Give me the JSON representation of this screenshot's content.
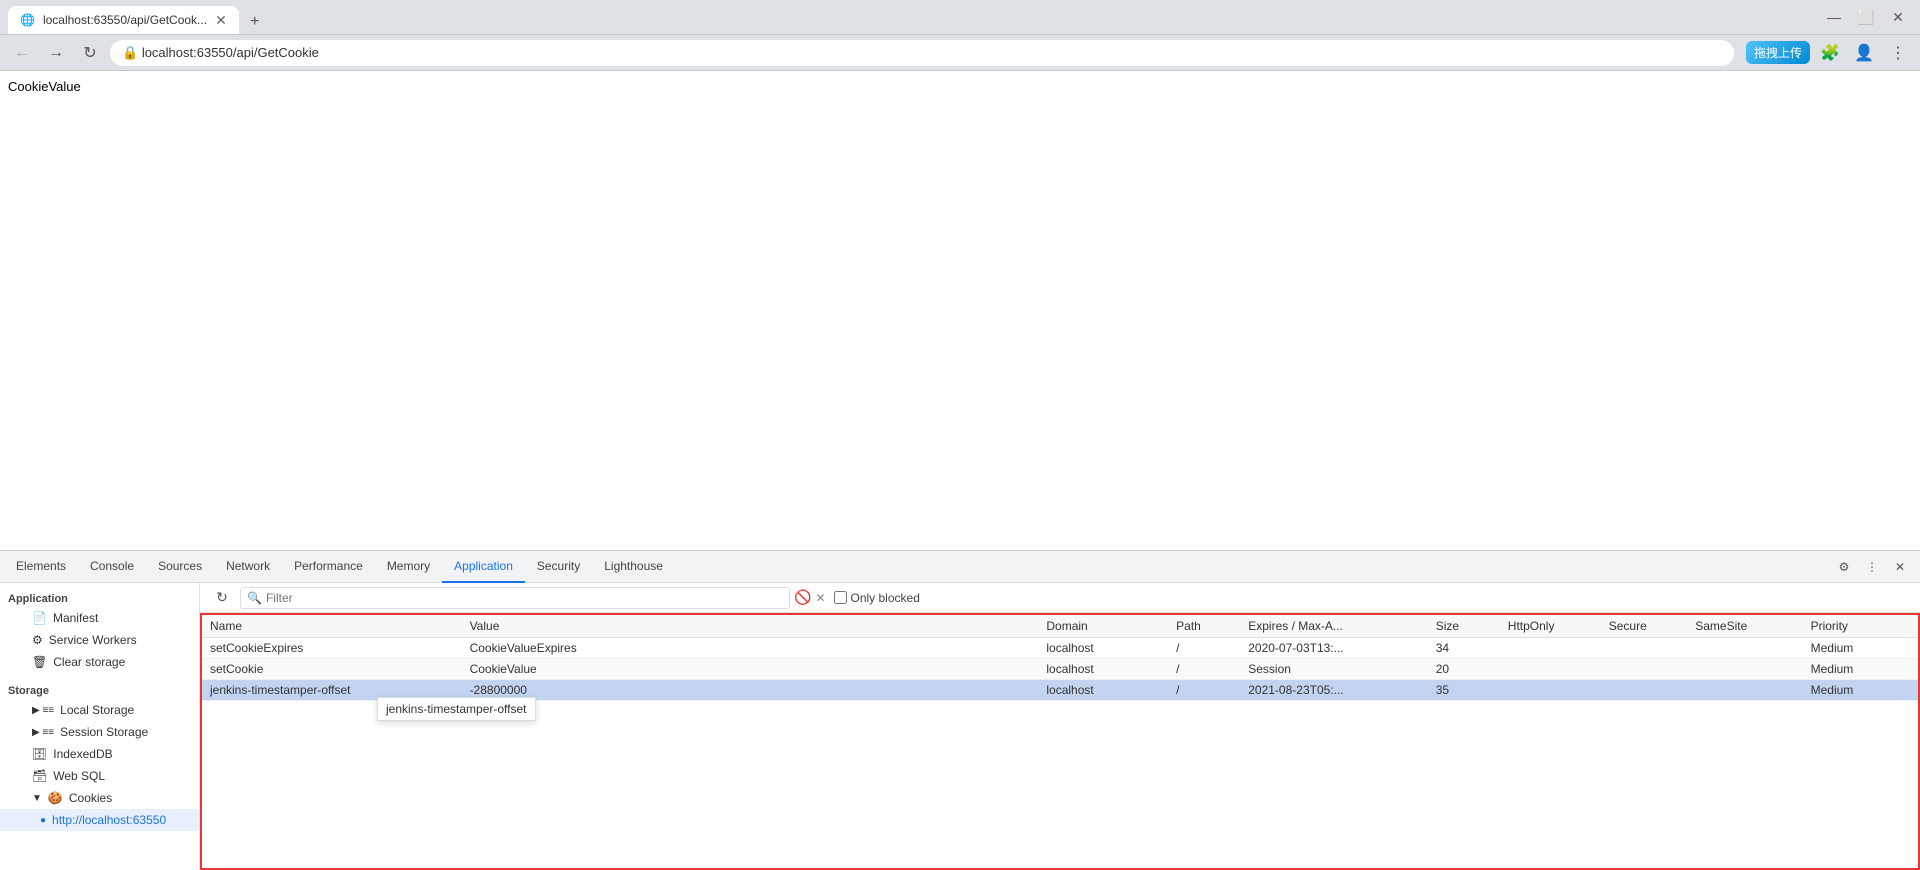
{
  "browser": {
    "tab_title": "localhost:63550/api/GetCook...",
    "tab_favicon": "🌐",
    "url": "localhost:63550/api/GetCookie",
    "new_tab_btn": "+",
    "back_disabled": false,
    "forward_disabled": true,
    "refresh_icon": "↻",
    "ext_label": "拖拽上传",
    "win_minimize": "—",
    "win_maximize": "⬜",
    "win_close": "✕"
  },
  "page": {
    "body_text": "CookieValue"
  },
  "devtools": {
    "tabs": [
      {
        "id": "elements",
        "label": "Elements"
      },
      {
        "id": "console",
        "label": "Console"
      },
      {
        "id": "sources",
        "label": "Sources"
      },
      {
        "id": "network",
        "label": "Network"
      },
      {
        "id": "performance",
        "label": "Performance"
      },
      {
        "id": "memory",
        "label": "Memory"
      },
      {
        "id": "application",
        "label": "Application",
        "active": true
      },
      {
        "id": "security",
        "label": "Security"
      },
      {
        "id": "lighthouse",
        "label": "Lighthouse"
      }
    ],
    "sidebar": {
      "application_label": "Application",
      "items": [
        {
          "id": "manifest",
          "label": "Manifest",
          "icon": "📄",
          "indent": 1
        },
        {
          "id": "service-workers",
          "label": "Service Workers",
          "icon": "⚙",
          "indent": 1
        },
        {
          "id": "clear-storage",
          "label": "Clear storage",
          "icon": "🗑",
          "indent": 1
        },
        {
          "id": "storage",
          "label": "Storage",
          "section": true
        },
        {
          "id": "local-storage",
          "label": "Local Storage",
          "icon": "≡≡",
          "indent": 1
        },
        {
          "id": "session-storage",
          "label": "Session Storage",
          "icon": "≡≡",
          "indent": 1
        },
        {
          "id": "indexeddb",
          "label": "IndexedDB",
          "icon": "🗄",
          "indent": 1
        },
        {
          "id": "web-sql",
          "label": "Web SQL",
          "icon": "🗃",
          "indent": 1
        },
        {
          "id": "cookies",
          "label": "Cookies",
          "icon": "🍪",
          "indent": 1,
          "expanded": true
        },
        {
          "id": "cookies-localhost",
          "label": "http://localhost:63550",
          "icon": "🔵",
          "indent": 2,
          "active": true
        }
      ]
    },
    "filter": {
      "placeholder": "Filter",
      "refresh_icon": "↻"
    },
    "cookie_table": {
      "columns": [
        {
          "id": "name",
          "label": "Name"
        },
        {
          "id": "value",
          "label": "Value"
        },
        {
          "id": "domain",
          "label": "Domain"
        },
        {
          "id": "path",
          "label": "Path"
        },
        {
          "id": "expires",
          "label": "Expires / Max-A..."
        },
        {
          "id": "size",
          "label": "Size"
        },
        {
          "id": "httponly",
          "label": "HttpOnly"
        },
        {
          "id": "secure",
          "label": "Secure"
        },
        {
          "id": "samesite",
          "label": "SameSite"
        },
        {
          "id": "priority",
          "label": "Priority"
        }
      ],
      "rows": [
        {
          "name": "setCookieExpires",
          "value": "CookieValueExpires",
          "domain": "localhost",
          "path": "/",
          "expires": "2020-07-03T13:...",
          "size": "34",
          "httponly": "",
          "secure": "",
          "samesite": "",
          "priority": "Medium",
          "selected": false
        },
        {
          "name": "setCookie",
          "value": "CookieValue",
          "domain": "localhost",
          "path": "/",
          "expires": "Session",
          "size": "20",
          "httponly": "",
          "secure": "",
          "samesite": "",
          "priority": "Medium",
          "selected": false
        },
        {
          "name": "jenkins-timestamper-offset",
          "value": "-28800000",
          "domain": "localhost",
          "path": "/",
          "expires": "2021-08-23T05:...",
          "size": "35",
          "httponly": "",
          "secure": "",
          "samesite": "",
          "priority": "Medium",
          "selected": true
        }
      ],
      "tooltip": "jenkins-timestamper-offset",
      "only_blocked_label": "Only blocked"
    }
  }
}
